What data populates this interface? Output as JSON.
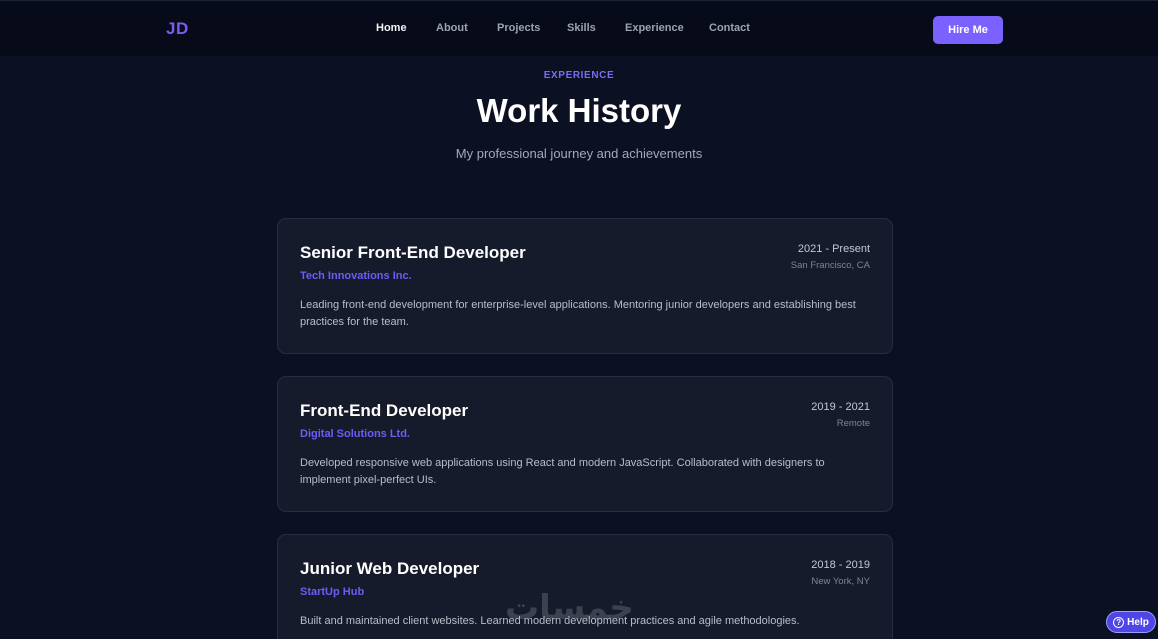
{
  "header": {
    "logo": "JD",
    "nav": [
      {
        "label": "Home",
        "active": true
      },
      {
        "label": "About",
        "active": false
      },
      {
        "label": "Projects",
        "active": false
      },
      {
        "label": "Skills",
        "active": false
      },
      {
        "label": "Experience",
        "active": false
      },
      {
        "label": "Contact",
        "active": false
      }
    ],
    "cta_label": "Hire Me"
  },
  "section": {
    "eyebrow": "EXPERIENCE",
    "title": "Work History",
    "subtitle": "My professional journey and achievements"
  },
  "jobs": [
    {
      "role": "Senior Front-End Developer",
      "company": "Tech Innovations Inc.",
      "dates": "2021 - Present",
      "location": "San Francisco, CA",
      "description": "Leading front-end development for enterprise-level applications. Mentoring junior developers and establishing best practices for the team."
    },
    {
      "role": "Front-End Developer",
      "company": "Digital Solutions Ltd.",
      "dates": "2019 - 2021",
      "location": "Remote",
      "description": "Developed responsive web applications using React and modern JavaScript. Collaborated with designers to implement pixel-perfect UIs."
    },
    {
      "role": "Junior Web Developer",
      "company": "StartUp Hub",
      "dates": "2018 - 2019",
      "location": "New York, NY",
      "description": "Built and maintained client websites. Learned modern development practices and agile methodologies."
    }
  ],
  "watermark": "خمسات",
  "help": {
    "label": "Help",
    "icon": "question-circle-icon"
  },
  "colors": {
    "background": "#0c1023",
    "navbar": "#070a18",
    "accent": "#7b61ff",
    "card": "#161b2b",
    "company_text": "#6d5cf5"
  }
}
